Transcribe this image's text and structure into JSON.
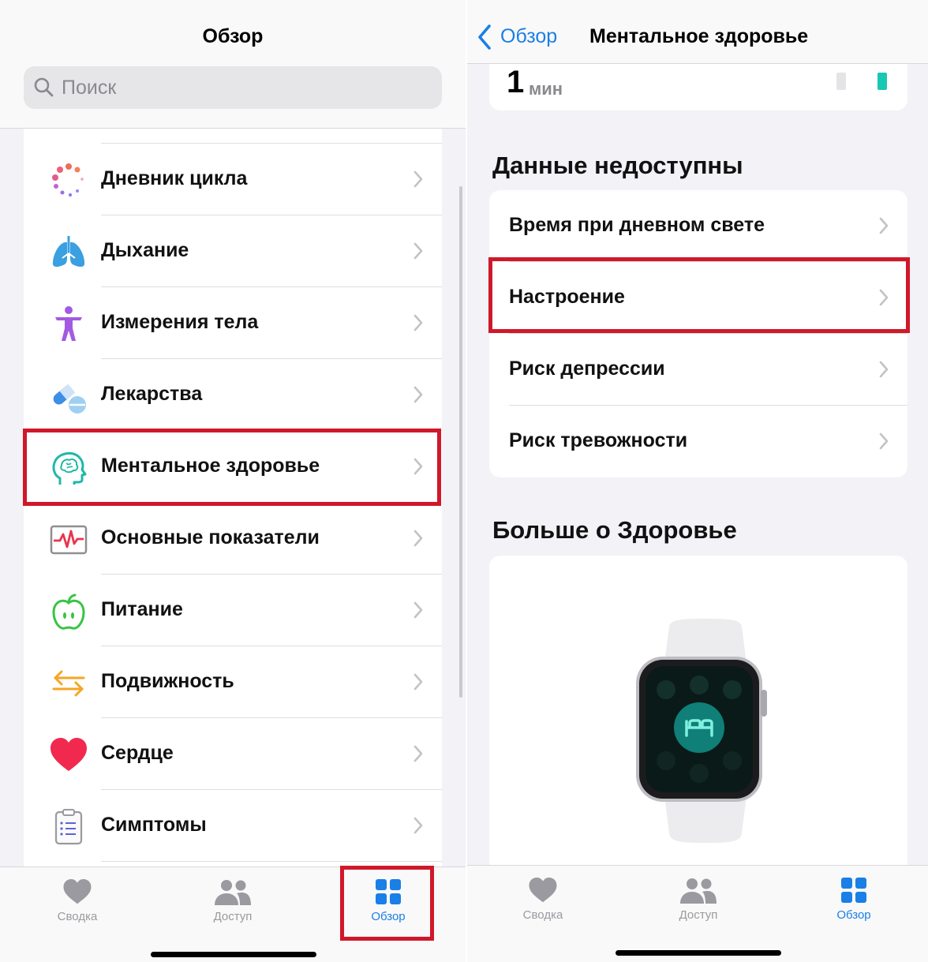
{
  "left": {
    "title": "Обзор",
    "search": {
      "placeholder": "Поиск"
    },
    "categories": [
      {
        "label": "Дневник цикла",
        "icon": "cycle-tracking-icon"
      },
      {
        "label": "Дыхание",
        "icon": "lungs-icon"
      },
      {
        "label": "Измерения тела",
        "icon": "body-measurements-icon"
      },
      {
        "label": "Лекарства",
        "icon": "medications-icon"
      },
      {
        "label": "Ментальное здоровье",
        "icon": "mental-health-icon"
      },
      {
        "label": "Основные показатели",
        "icon": "vitals-icon"
      },
      {
        "label": "Питание",
        "icon": "nutrition-apple-icon"
      },
      {
        "label": "Подвижность",
        "icon": "mobility-arrows-icon"
      },
      {
        "label": "Сердце",
        "icon": "heart-icon"
      },
      {
        "label": "Симптомы",
        "icon": "symptoms-clipboard-icon"
      }
    ],
    "highlighted_item": "Ментальное здоровье",
    "tabbar": {
      "tabs": [
        {
          "label": "Сводка",
          "icon": "heart-icon"
        },
        {
          "label": "Доступ",
          "icon": "people-icon"
        },
        {
          "label": "Обзор",
          "icon": "grid-icon"
        }
      ],
      "active": "Обзор"
    }
  },
  "right": {
    "nav": {
      "back_label": "Обзор",
      "title": "Ментальное здоровье"
    },
    "stat": {
      "value": "1",
      "unit": "мин"
    },
    "section_unavailable": {
      "title": "Данные недоступны",
      "items": [
        {
          "label": "Время при дневном свете"
        },
        {
          "label": "Настроение"
        },
        {
          "label": "Риск депрессии"
        },
        {
          "label": "Риск тревожности"
        }
      ]
    },
    "highlighted_item": "Настроение",
    "section_more": {
      "title": "Больше о Здоровье",
      "image": "apple-watch-sleep-icon"
    },
    "tabbar": {
      "tabs": [
        {
          "label": "Сводка",
          "icon": "heart-icon"
        },
        {
          "label": "Доступ",
          "icon": "people-icon"
        },
        {
          "label": "Обзор",
          "icon": "grid-icon"
        }
      ],
      "active": "Обзор"
    }
  },
  "colors": {
    "accent": "#1a7fe6",
    "highlight": "#d0182a",
    "background": "#f2f2f7",
    "teal": "#19c7b3"
  }
}
